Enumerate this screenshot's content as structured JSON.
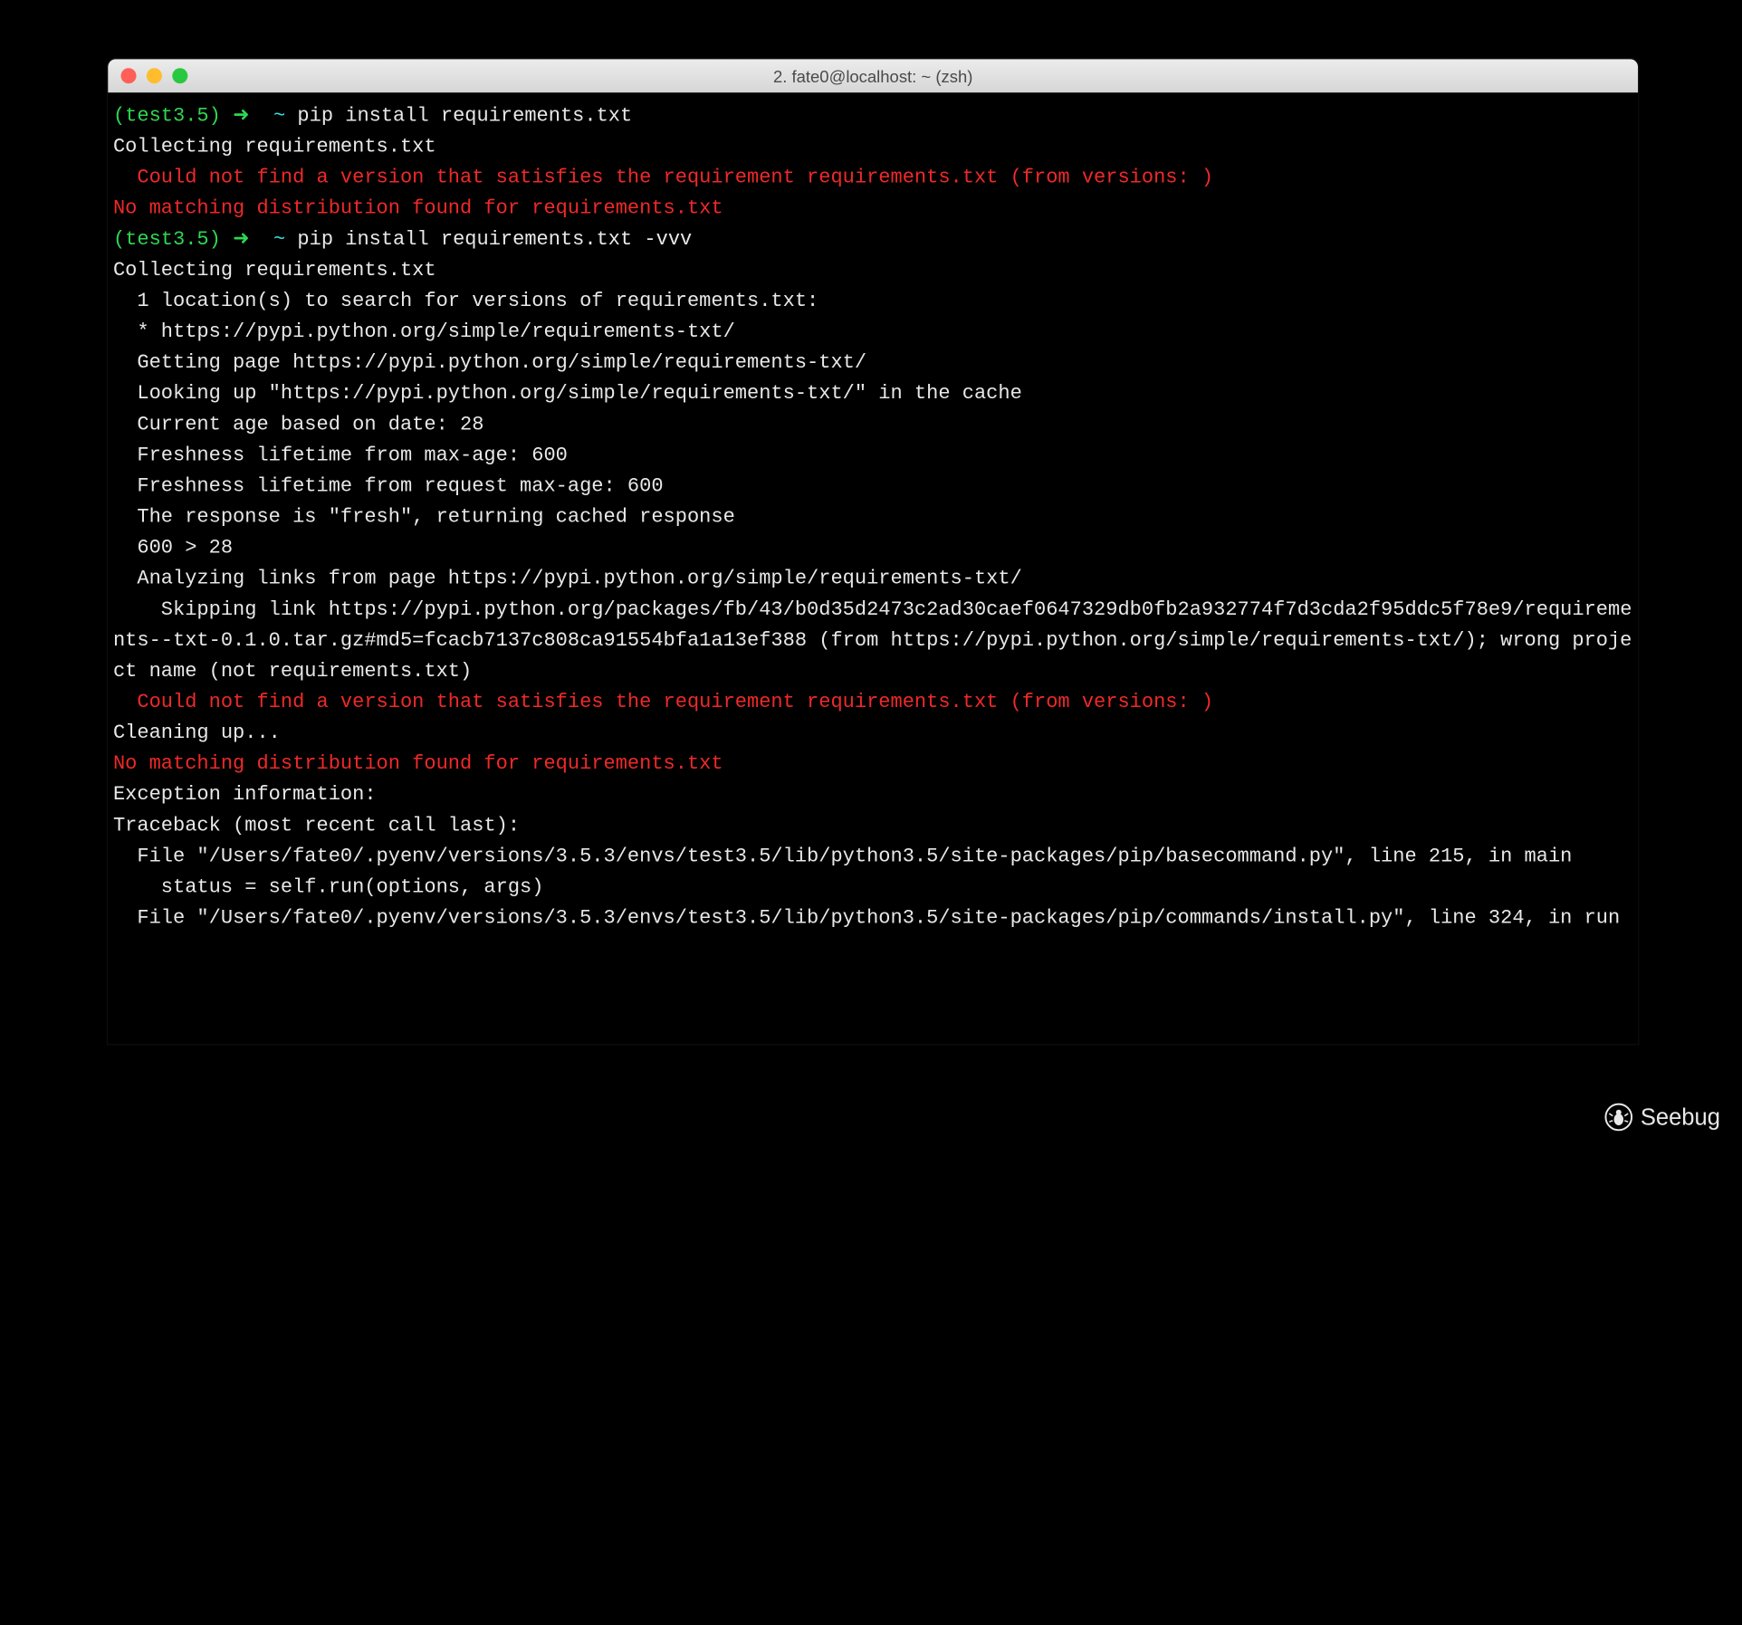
{
  "window": {
    "title": "2. fate0@localhost: ~ (zsh)"
  },
  "prompt": {
    "venv": "(test3.5)",
    "arrow": "➜",
    "cwd": "~"
  },
  "commands": {
    "cmd1": "pip install requirements.txt",
    "cmd2": "pip install requirements.txt -vvv"
  },
  "out": {
    "collecting": "Collecting requirements.txt",
    "err_nover": "  Could not find a version that satisfies the requirement requirements.txt (from versions: )",
    "err_nomatch": "No matching distribution found for requirements.txt",
    "l1": "  1 location(s) to search for versions of requirements.txt:",
    "l2": "  * https://pypi.python.org/simple/requirements-txt/",
    "l3": "  Getting page https://pypi.python.org/simple/requirements-txt/",
    "l4": "  Looking up \"https://pypi.python.org/simple/requirements-txt/\" in the cache",
    "l5": "  Current age based on date: 28",
    "l6": "  Freshness lifetime from max-age: 600",
    "l7": "  Freshness lifetime from request max-age: 600",
    "l8": "  The response is \"fresh\", returning cached response",
    "l9": "  600 > 28",
    "l10": "  Analyzing links from page https://pypi.python.org/simple/requirements-txt/",
    "l11": "    Skipping link https://pypi.python.org/packages/fb/43/b0d35d2473c2ad30caef0647329db0fb2a932774f7d3cda2f95ddc5f78e9/requirements--txt-0.1.0.tar.gz#md5=fcacb7137c808ca91554bfa1a13ef388 (from https://pypi.python.org/simple/requirements-txt/); wrong project name (not requirements.txt)",
    "cleaning": "Cleaning up...",
    "exinfo": "Exception information:",
    "tb": "Traceback (most recent call last):",
    "tb1": "  File \"/Users/fate0/.pyenv/versions/3.5.3/envs/test3.5/lib/python3.5/site-packages/pip/basecommand.py\", line 215, in main",
    "tb1b": "    status = self.run(options, args)",
    "tb2": "  File \"/Users/fate0/.pyenv/versions/3.5.3/envs/test3.5/lib/python3.5/site-packages/pip/commands/install.py\", line 324, in run"
  },
  "watermark": {
    "text": "Seebug"
  }
}
